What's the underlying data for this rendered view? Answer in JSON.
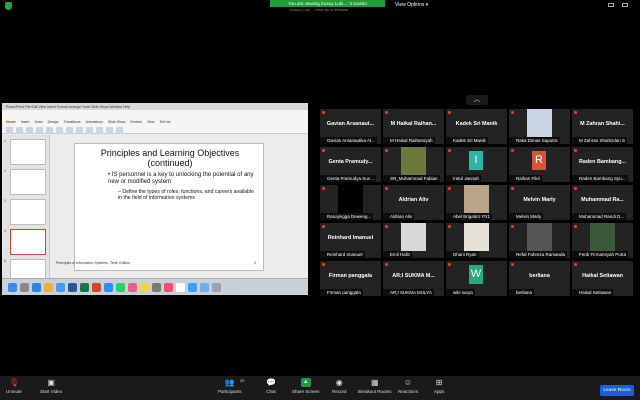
{
  "topbar": {
    "viewing_banner": "You are viewing Kusuy Lubi… 's screen",
    "viewing_sub": "Kusuy Lubi…  View as in Window",
    "view_options": "View Options ▾"
  },
  "powerpoint": {
    "menu": "PowerPoint  File  Edit  View  Insert  Format  Arrange  Tools  Slide Show  Window  Help",
    "tabs": [
      "Home",
      "Insert",
      "Draw",
      "Design",
      "Transitions",
      "Animations",
      "Slide Show",
      "Review",
      "View",
      "Tell me"
    ],
    "slide": {
      "title": "Principles and Learning Objectives (continued)",
      "bullet": "• IS personnel is a key to unlocking the potential of any new or modified system",
      "sub_bullet": "– Define the types of roles, functions, and careers available in the field of information systems",
      "footer": "Principles of Information Systems, Tenth Edition",
      "number": "4"
    },
    "thumb_numbers": [
      "1",
      "2",
      "3",
      "4",
      "5"
    ],
    "notes_label": "Click to add notes"
  },
  "gallery": {
    "expand_icon": "chevron-up-icon",
    "tiles": [
      {
        "name": "Gavian  Arsanaut...",
        "label": "Gavian Arsanautika Al..."
      },
      {
        "name": "M  Haikal  Raihan...",
        "label": "M Haikal Raihansyah"
      },
      {
        "name": "Kadek Sri Manik",
        "label": "Kadek Sri Manik"
      },
      {
        "name": "",
        "label": "Raka Dimas Saputra",
        "photo": "#c9d3e6"
      },
      {
        "name": "M  Zahran  Shahi...",
        "label": "M Zahran Shahizdan S"
      },
      {
        "name": "Genta  Pramudy...",
        "label": "Genta Pramudya Sun..."
      },
      {
        "name": "",
        "label": "SR_Muhammad Fabian",
        "photo": "#6a7a3a"
      },
      {
        "name": "",
        "label": "Iratul Jannah",
        "letter": "I",
        "letter_color": "#2bb5a5"
      },
      {
        "name": "",
        "label": "Raihan Fikri",
        "letter": "R",
        "letter_color": "#d9523c"
      },
      {
        "name": "Raden  Bambang...",
        "label": "Raden Bambang Syu..."
      },
      {
        "name": "",
        "label": "Ranajingga Deweng...",
        "photo": "#000000"
      },
      {
        "name": "Aldrian Aliv",
        "label": "Aldrian Aliv"
      },
      {
        "name": "",
        "label": "Abel Brigatinz P21",
        "photo": "#b8a58a"
      },
      {
        "name": "Melvin Marly",
        "label": "Melvin Marly"
      },
      {
        "name": "Muhammad  Ra...",
        "label": "Muhammad Randi D..."
      },
      {
        "name": "Reinhard Imanuel",
        "label": "Reinhard Imanuel"
      },
      {
        "name": "",
        "label": "Emil Hafiz",
        "photo": "#d8d8d8"
      },
      {
        "name": "",
        "label": "Dhani Ryan",
        "photo": "#e6e2da"
      },
      {
        "name": "",
        "label": "Refal Fahreza Ramanda",
        "photo": "#555555"
      },
      {
        "name": "",
        "label": "Ferdi Firmansyah Putra",
        "photo": "#3a5a3a"
      },
      {
        "name": "Firman panggala",
        "label": "Firman panggala"
      },
      {
        "name": "AR;I  SUKMA  M...",
        "label": "AR;I SUKMA MULYA"
      },
      {
        "name": "",
        "label": "wiki surya",
        "letter": "W",
        "letter_color": "#2aa87a"
      },
      {
        "name": "berliana",
        "label": "berliana"
      },
      {
        "name": "Haikal Setiawan",
        "label": "Haikal Setiawan"
      }
    ]
  },
  "toolbar": {
    "unmute": "Unmute",
    "start_video": "Start Video",
    "participants": "Participants",
    "participants_count": "29",
    "chat": "Chat",
    "share_screen": "Share Screen",
    "record": "Record",
    "breakout_rooms": "Breakout Rooms",
    "reactions": "Reactions",
    "apps": "Apps",
    "leave": "Leave Room"
  },
  "colors": {
    "share_green": "#1f9d3a",
    "leave_blue": "#1e5fd9",
    "mic_red": "#e03c31"
  }
}
